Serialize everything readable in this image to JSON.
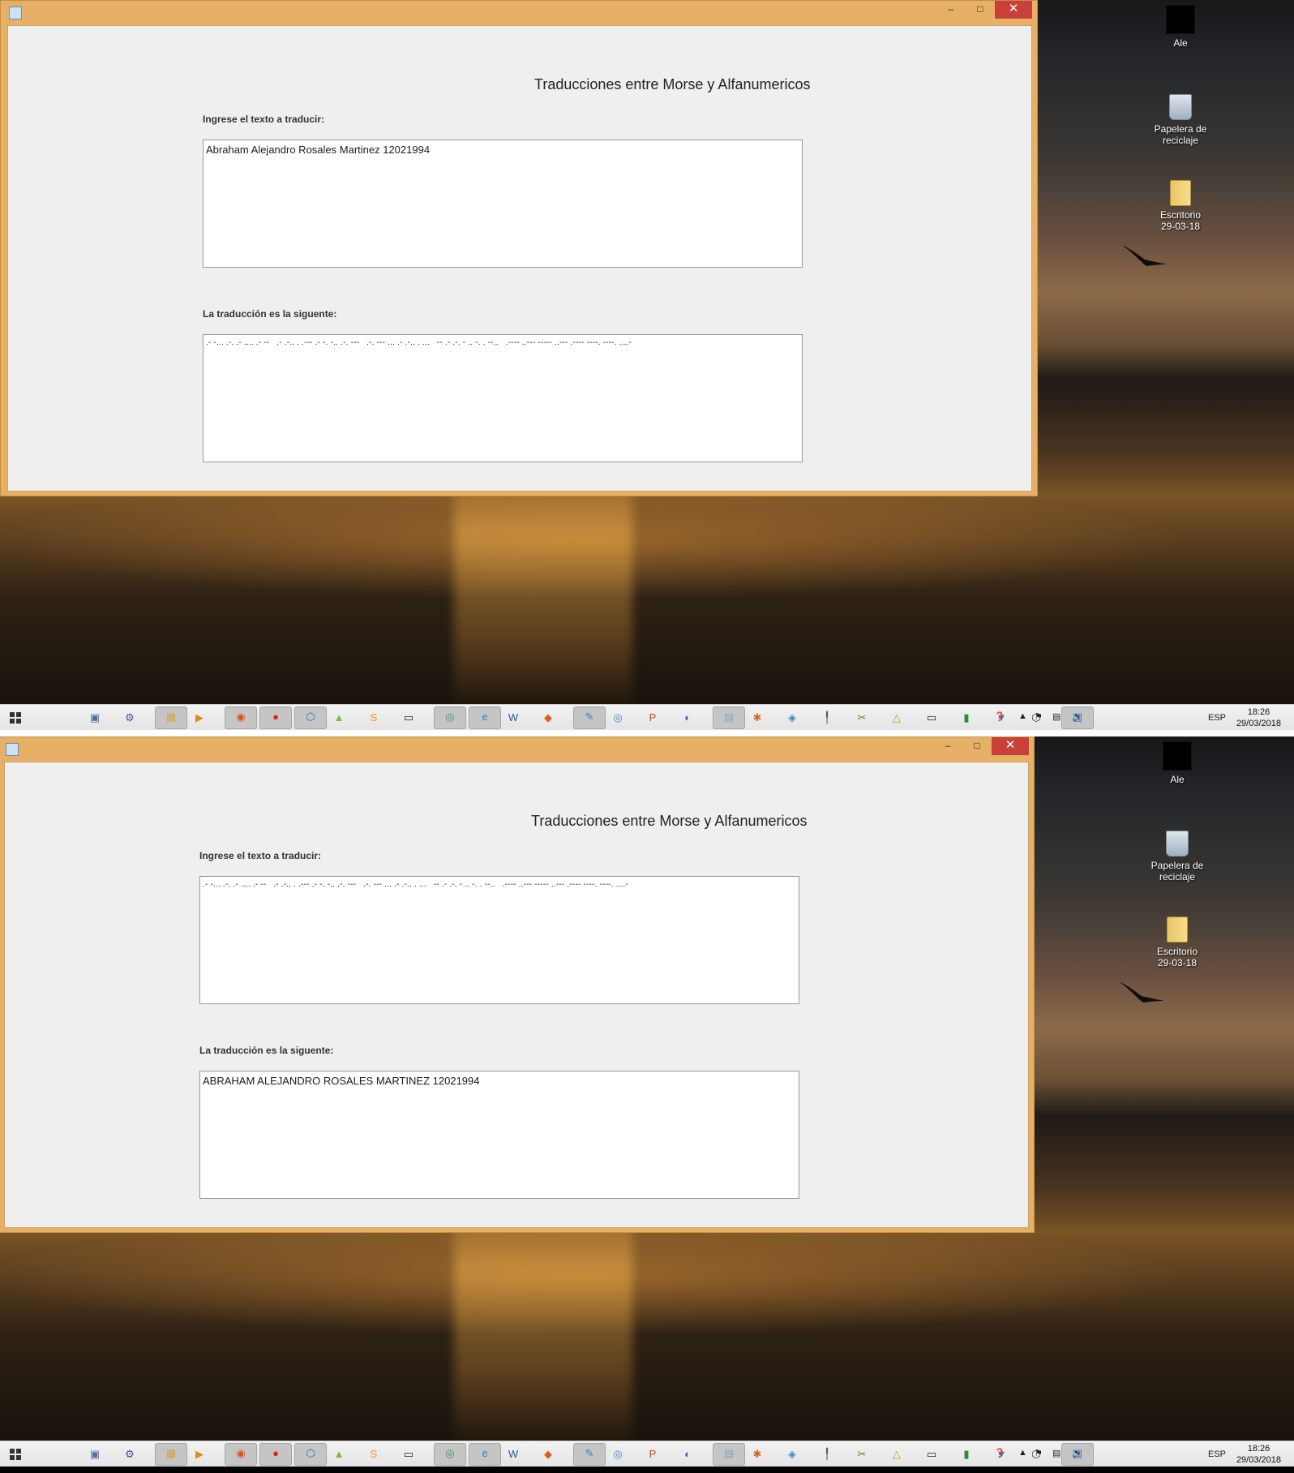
{
  "screens": [
    {
      "id": "top",
      "window": {
        "title": "",
        "controls": {
          "minimize": "–",
          "maximize": "□",
          "close": "✕"
        },
        "app_title": "Traducciones entre Morse y Alfanumericos",
        "input_label": "Ingrese el texto a traducir:",
        "input_value": "Abraham Alejandro Rosales Martinez 12021994",
        "output_label": "La traducción es la siguente:",
        "output_value": ".- -... .-. .- .... .- --   .- .-.. . .--- .- -. -.. .-. ---   .-. --- ... .- .-.. . ...   -- .- .-. - .. -. . --..   .---- ..--- ----- ..--- .---- ----. ----. ....-"
      }
    },
    {
      "id": "bottom",
      "window": {
        "title": "",
        "controls": {
          "minimize": "–",
          "maximize": "□",
          "close": "✕"
        },
        "app_title": "Traducciones entre Morse y Alfanumericos",
        "input_label": "Ingrese el texto a traducir:",
        "input_value": ".- -... .-. .- .... .- --   .- .-.. . .--- .- -. -.. .-. ---   .-. --- ... .- .-.. . ...   -- .- .-. - .. -. . --..   .---- ..--- ----- ..--- .---- ----. ----. ....-",
        "output_label": "La traducción es la siguente:",
        "output_value": "ABRAHAM ALEJANDRO ROSALES MARTINEZ 12021994"
      }
    }
  ],
  "desktop_icons": [
    {
      "label": "Ale",
      "icon": "black-square-icon"
    },
    {
      "label_line1": "Papelera de",
      "label_line2": "reciclaje",
      "icon": "recycle-bin-icon"
    },
    {
      "label_line1": "Escritorio",
      "label_line2": "29-03-18",
      "icon": "folder-icon"
    }
  ],
  "taskbar": {
    "apps": [
      "start-icon",
      "network-icon",
      "settings-icon",
      "file-explorer-icon",
      "media-player-icon",
      "firefox-icon",
      "opera-icon",
      "virtualbox-icon",
      "android-studio-icon",
      "sublime-icon",
      "cmd-icon",
      "chrome-icon",
      "ie-icon",
      "word-icon",
      "brackets-icon",
      "paint-icon",
      "cortana-icon",
      "powerpoint-icon",
      "eclipse-icon",
      "notepad-icon",
      "xampp-icon",
      "netbeans-icon",
      "pen-icon",
      "tools-icon",
      "geogebra-icon",
      "terminal-icon",
      "battery-app-icon",
      "java-icon",
      "unity-icon",
      "java-app-icon",
      "help-icon"
    ],
    "tray": {
      "language": "ESP",
      "time": "18:26",
      "date": "29/03/2018"
    }
  },
  "colors": {
    "window_frame": "#e6b167",
    "close_button": "#c7403a",
    "client_bg": "#efefef",
    "taskbar_bg": "#e8e8e8"
  }
}
